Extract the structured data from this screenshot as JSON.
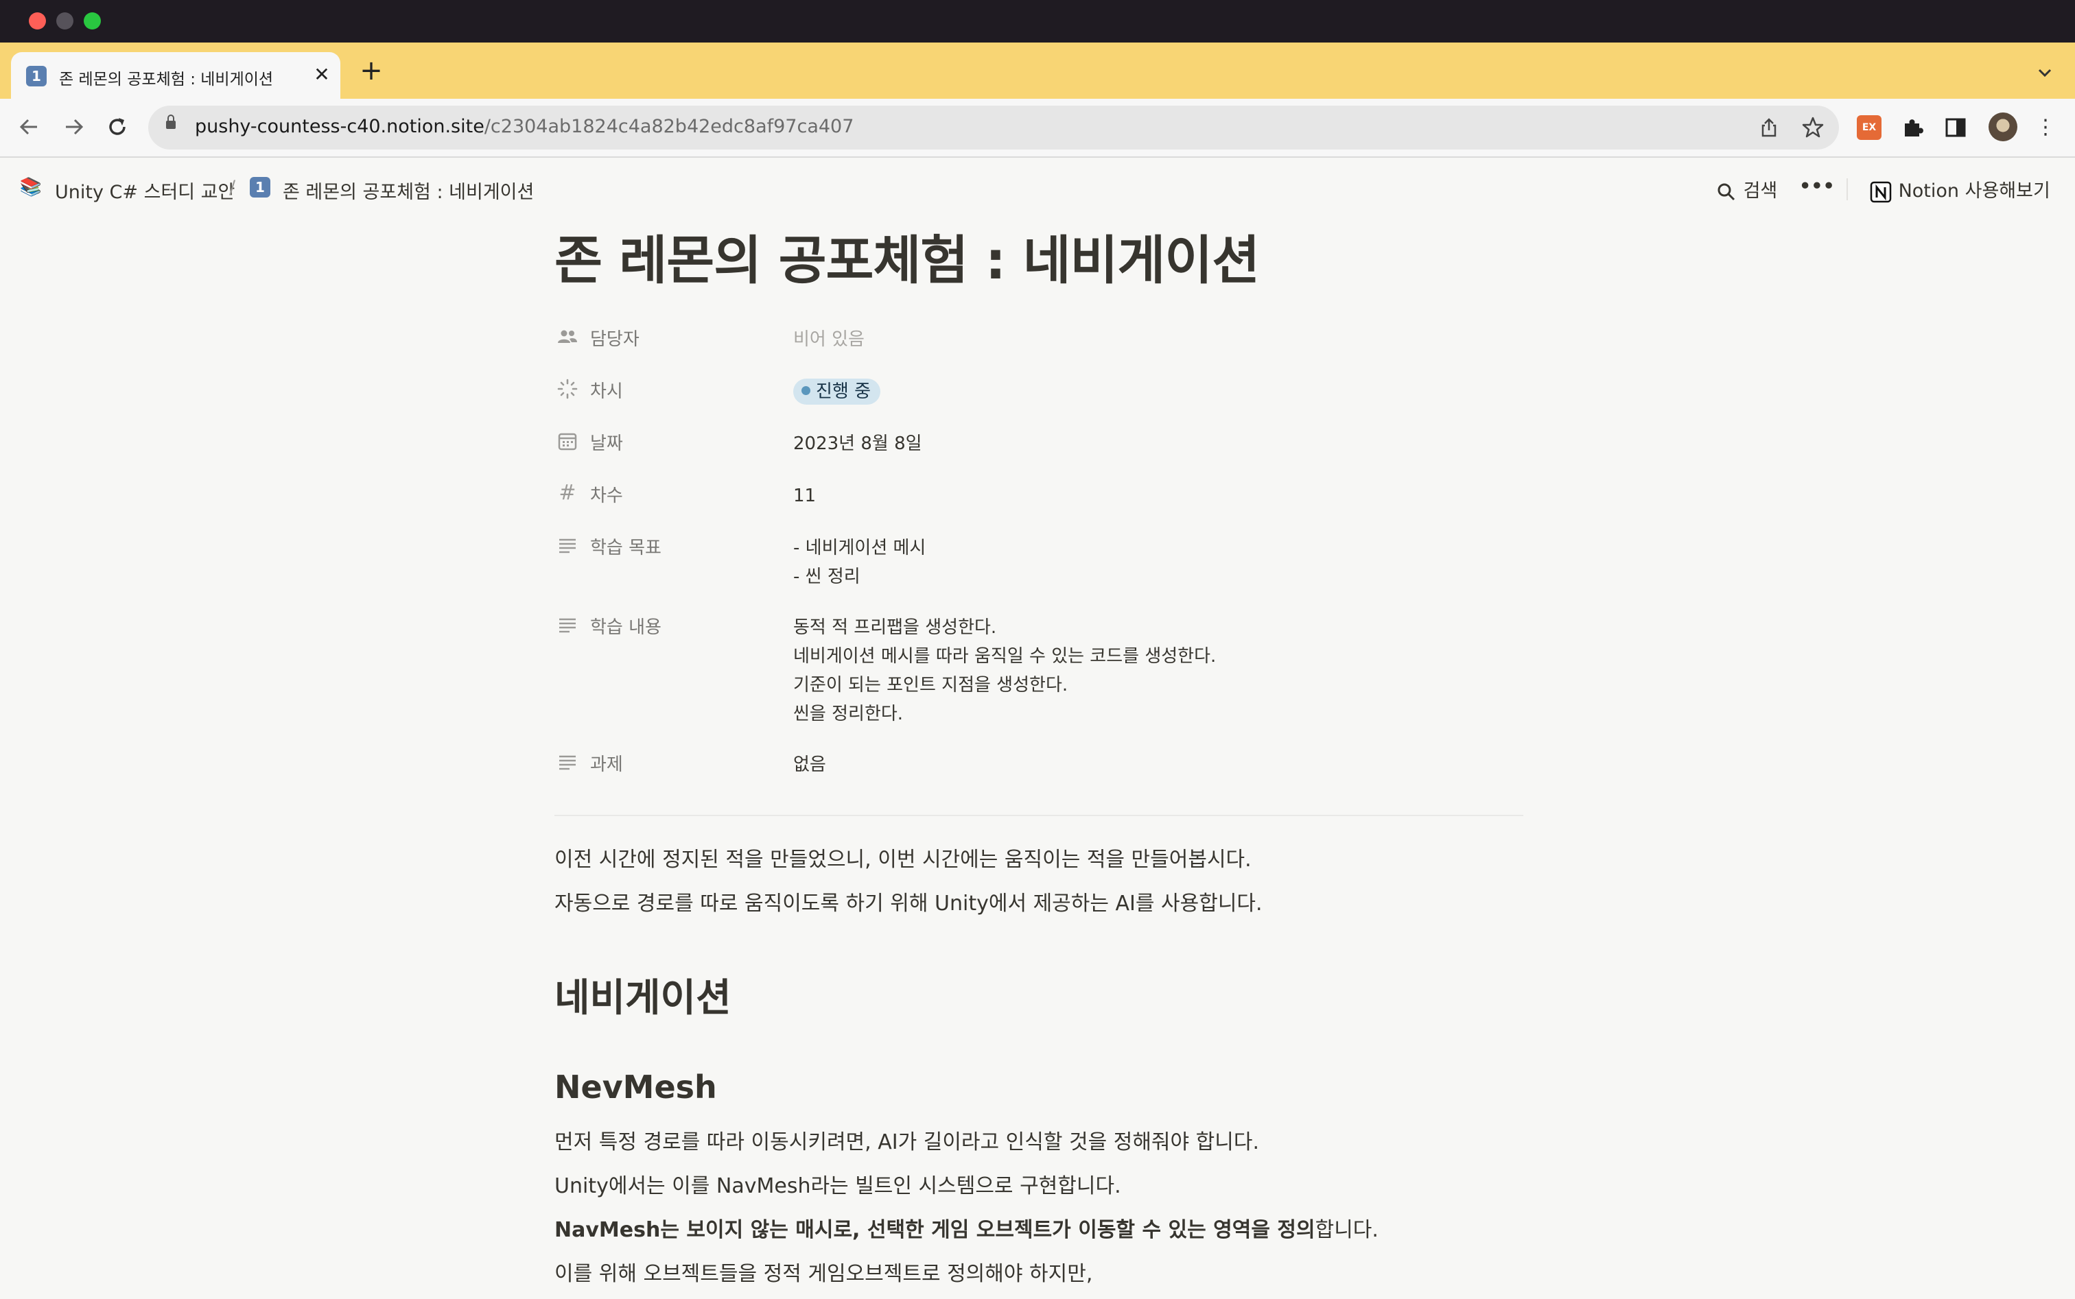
{
  "browser": {
    "tab": {
      "title": "존 레몬의 공포체험 : 네비게이션",
      "favicon": "1️⃣"
    },
    "url_host": "pushy-countess-c40.notion.site",
    "url_path": "/c2304ab1824c4a82b42edc8af97ca407",
    "ext_badge": "EX"
  },
  "topbar": {
    "crumb_parent_icon": "📚",
    "crumb_parent": "Unity C# 스터디 교안",
    "crumb_sep": "/",
    "crumb_current_icon": "1️⃣",
    "crumb_current": "존 레몬의 공포체험 : 네비게이션",
    "search_label": "검색",
    "more_label": "•••",
    "try_notion_label": "Notion 사용해보기"
  },
  "page": {
    "title": "존 레몬의 공포체험 : 네비게이션",
    "properties": {
      "assignee": {
        "name": "담당자",
        "value": "비어 있음"
      },
      "status": {
        "name": "차시",
        "value": "진행 중"
      },
      "date": {
        "name": "날짜",
        "value": "2023년 8월 8일"
      },
      "number": {
        "name": "차수",
        "value": "11"
      },
      "goal": {
        "name": "학습 목표",
        "lines": [
          "- 네비게이션 메시",
          "- 씬 정리"
        ]
      },
      "content": {
        "name": "학습 내용",
        "lines": [
          "동적 적 프리팹을 생성한다.",
          "네비게이션 메시를 따라 움직일 수 있는 코드를 생성한다.",
          "기준이 되는 포인트 지점을 생성한다.",
          "씬을 정리한다."
        ]
      },
      "homework": {
        "name": "과제",
        "value": "없음"
      }
    },
    "intro": [
      "이전 시간에 정지된 적을 만들었으니, 이번 시간에는 움직이는 적을 만들어봅시다.",
      "자동으로 경로를 따로 움직이도록 하기 위해 Unity에서 제공하는 AI를 사용합니다."
    ],
    "heading1": "네비게이션",
    "heading2": "NevMesh",
    "body": {
      "p1": "먼저 특정 경로를 따라 이동시키려면, AI가 길이라고 인식할 것을 정해줘야 합니다.",
      "p2": "Unity에서는 이를 NavMesh라는 빌트인 시스템으로 구현합니다.",
      "p3_bold": "NavMesh는 보이지 않는 매시로, 선택한 게임 오브젝트가 이동할 수 있는 영역을 정의",
      "p3_rest": "합니다.",
      "p4": "이를 위해 오브젝트들을 정적 게임오브젝트로 정의해야 하지만,"
    }
  }
}
